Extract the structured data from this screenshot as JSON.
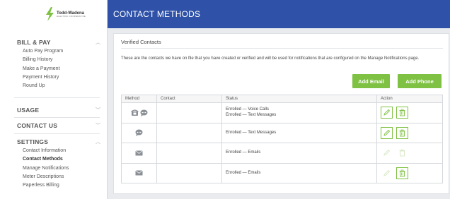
{
  "brand": {
    "name": "Todd-Wadena",
    "sub": "ELECTRIC COOPERATIVE"
  },
  "header": {
    "title": "CONTACT METHODS"
  },
  "sidebar": {
    "sections": [
      {
        "label": "BILL & PAY",
        "expanded": true,
        "items": [
          "Auto Pay Program",
          "Billing History",
          "Make a Payment",
          "Payment History",
          "Round Up"
        ]
      },
      {
        "label": "USAGE",
        "expanded": false,
        "items": []
      },
      {
        "label": "CONTACT US",
        "expanded": false,
        "items": []
      },
      {
        "label": "SETTINGS",
        "expanded": true,
        "items": [
          "Contact Information",
          "Contact Methods",
          "Manage Notifications",
          "Meter Descriptions",
          "Paperless Billing"
        ]
      }
    ],
    "active_item": "Contact Methods"
  },
  "card": {
    "title": "Verified Contacts",
    "description": "These are the contacts we have on file that you have created or verified and will be used for notifications that are configured on the Manage Notifications page.",
    "add_email_label": "Add Email",
    "add_phone_label": "Add Phone"
  },
  "table": {
    "columns": [
      "Method",
      "Contact",
      "Status",
      "Action"
    ],
    "rows": [
      {
        "methods": [
          "phone-icon",
          "chat-icon"
        ],
        "contact": "",
        "status": [
          "Enrolled — Voice Calls",
          "Enrolled — Text Messages"
        ],
        "editable": true
      },
      {
        "methods": [
          "chat-icon"
        ],
        "contact": "",
        "status": [
          "Enrolled — Text Messages"
        ],
        "editable": true
      },
      {
        "methods": [
          "email-icon"
        ],
        "contact": "",
        "status": [
          "Enrolled — Emails"
        ],
        "editable": false
      },
      {
        "methods": [
          "email-icon"
        ],
        "contact": "",
        "status": [
          "Enrolled — Emails"
        ],
        "editable": false,
        "delete_enabled": true
      }
    ]
  },
  "colors": {
    "header_bg": "#2f52a8",
    "accent_green": "#7fc143",
    "icon_gray": "#8a8f95"
  }
}
